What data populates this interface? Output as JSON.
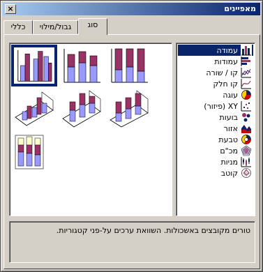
{
  "window": {
    "title": "מאפיינים",
    "close_glyph": "×"
  },
  "tabs": [
    {
      "label": "סוג",
      "active": true
    },
    {
      "label": "גבול/מילוי",
      "active": false
    },
    {
      "label": "כללי",
      "active": false
    }
  ],
  "chart_types": [
    {
      "label": "עמודה",
      "icon": "column-chart-icon",
      "selected": true
    },
    {
      "label": "עמודות",
      "icon": "bar-chart-icon",
      "selected": false
    },
    {
      "label": "קו / שורה",
      "icon": "line-chart-icon",
      "selected": false
    },
    {
      "label": "קו חלק",
      "icon": "smooth-line-chart-icon",
      "selected": false
    },
    {
      "label": "עוגה",
      "icon": "pie-chart-icon",
      "selected": false
    },
    {
      "label": "XY (פיזור)",
      "icon": "scatter-chart-icon",
      "selected": false
    },
    {
      "label": "בועות",
      "icon": "bubble-chart-icon",
      "selected": false
    },
    {
      "label": "אזור",
      "icon": "area-chart-icon",
      "selected": false
    },
    {
      "label": "טבעת",
      "icon": "doughnut-chart-icon",
      "selected": false
    },
    {
      "label": "מכ\"ם",
      "icon": "radar-chart-icon",
      "selected": false
    },
    {
      "label": "מניות",
      "icon": "stock-chart-icon",
      "selected": false
    },
    {
      "label": "קוטב",
      "icon": "polar-chart-icon",
      "selected": false
    }
  ],
  "subtypes": [
    {
      "name": "clustered-column",
      "selected": true
    },
    {
      "name": "stacked-column",
      "selected": false
    },
    {
      "name": "percent-stacked-column",
      "selected": false
    },
    {
      "name": "clustered-column-3d",
      "selected": false
    },
    {
      "name": "stacked-column-3d",
      "selected": false
    },
    {
      "name": "percent-stacked-column-3d",
      "selected": false
    },
    {
      "name": "column-3d",
      "selected": false
    }
  ],
  "description": "טורים מקובצים באשכולות. השוואת ערכים על-פני קטגוריות.",
  "colors": {
    "series1": "#9999ff",
    "series2": "#993366",
    "series3": "#ffffcc",
    "selection": "#0a246a"
  }
}
